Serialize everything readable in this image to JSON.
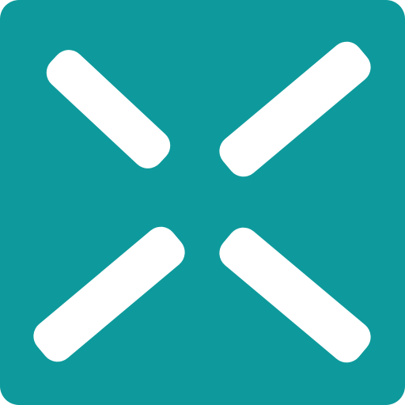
{
  "icon": {
    "name": "x-logo-icon",
    "background_color": "#0e9a9c",
    "glyph_color": "#ffffff"
  }
}
